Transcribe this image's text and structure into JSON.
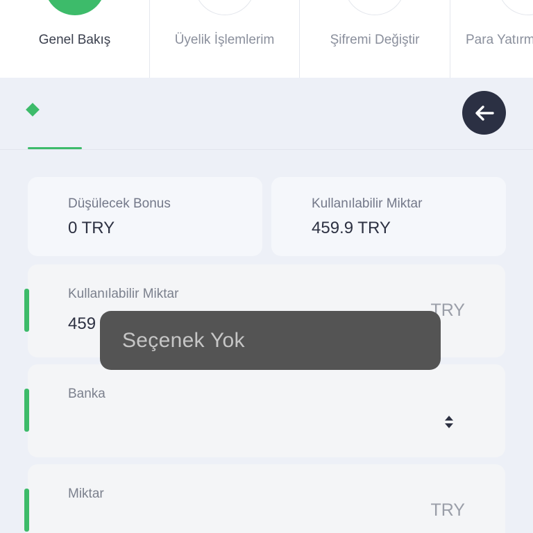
{
  "tabs": [
    {
      "label": "Genel Bakış",
      "active": true
    },
    {
      "label": "Üyelik İşlemlerim",
      "active": false
    },
    {
      "label": "Şifremi Değiştir",
      "active": false
    },
    {
      "label": "Para Yatırm",
      "active": false
    }
  ],
  "header": {
    "back_icon": "arrow-left-icon",
    "marker_icon": "diamond-icon"
  },
  "summary": {
    "bonus": {
      "label": "Düşülecek Bonus",
      "value": "0 TRY"
    },
    "available": {
      "label": "Kullanılabilir Miktar",
      "value": "459.9 TRY"
    }
  },
  "form": {
    "available_field": {
      "label": "Kullanılabilir Miktar",
      "value": "459",
      "unit": "TRY"
    },
    "bank_field": {
      "label": "Banka",
      "value": "",
      "icon": "select-arrows-icon"
    },
    "amount_field": {
      "label": "Miktar",
      "value": "",
      "unit": "TRY"
    }
  },
  "toast": {
    "message": "Seçenek Yok"
  },
  "colors": {
    "accent": "#3dbb6a",
    "dark_button": "#2b3043",
    "toast_bg": "#545454",
    "page_bg": "#edf0f7"
  }
}
